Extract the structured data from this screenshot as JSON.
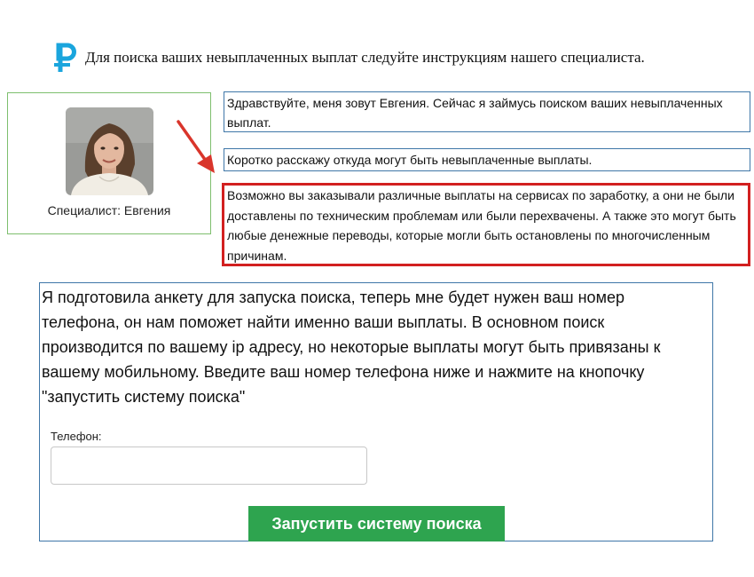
{
  "header": {
    "icon": "ruble-icon",
    "text": "Для поиска ваших невыплаченных выплат следуйте инструкциям нашего специалиста."
  },
  "specialist": {
    "caption": "Специалист: Евгения"
  },
  "messages": [
    "Здравствуйте, меня зовут Евгения. Сейчас я займусь поиском ваших невыплаченных выплат.",
    "Коротко расскажу откуда могут быть невыплаченные выплаты.",
    "Возможно вы заказывали различные выплаты на сервисах по заработку, а они не были доставлены по техническим проблемам или были перехвачены. А также это могут быть любые денежные переводы, которые могли быть остановлены по многочисленным причинам."
  ],
  "form": {
    "intro": "Я подготовила анкету для запуска поиска, теперь мне будет нужен ваш номер телефона, он нам поможет найти именно ваши выплаты. В основном поиск производится по вашему ip адресу, но некоторые выплаты могут быть привязаны к вашему мобильному. Введите ваш номер телефона ниже и нажмите на кнопочку \"запустить систему поиска\"",
    "phone_label": "Телефон:",
    "phone_value": "",
    "button_label": "Запустить систему поиска"
  },
  "colors": {
    "ruble_icon": "#1aa5dd",
    "button": "#2ea44f",
    "highlight_border": "#d22020",
    "message_border": "#3f77a8",
    "card_border": "#7ebf6e"
  }
}
